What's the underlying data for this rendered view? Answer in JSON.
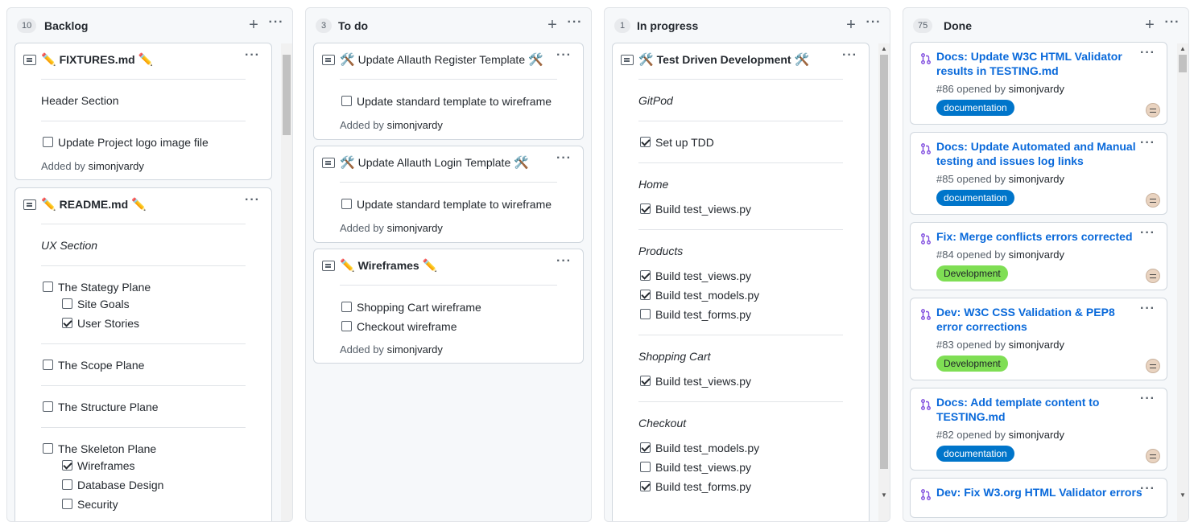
{
  "columns": [
    {
      "count": "10",
      "title": "Backlog",
      "cards": [
        {
          "kind": "note",
          "title": "FIXTURES.md",
          "emoji": "✏️",
          "items": [
            {
              "type": "text",
              "text": "Header Section"
            },
            {
              "type": "check",
              "text": "Update Project logo image file",
              "checked": false
            }
          ],
          "added_prefix": "Added by",
          "added_user": "simonjvardy"
        },
        {
          "kind": "note",
          "title": "README.md",
          "emoji": "✏️",
          "items": [
            {
              "type": "italic",
              "text": "UX Section"
            },
            {
              "type": "check",
              "text": "The Stategy Plane",
              "checked": false
            },
            {
              "type": "subcheck",
              "text": "Site Goals",
              "checked": false
            },
            {
              "type": "subcheck",
              "text": "User Stories",
              "checked": true
            },
            {
              "type": "check",
              "text": "The Scope Plane",
              "checked": false
            },
            {
              "type": "check",
              "text": "The Structure Plane",
              "checked": false
            },
            {
              "type": "check",
              "text": "The Skeleton Plane",
              "checked": false
            },
            {
              "type": "subcheck",
              "text": "Wireframes",
              "checked": true
            },
            {
              "type": "subcheck",
              "text": "Database Design",
              "checked": false
            },
            {
              "type": "subcheck",
              "text": "Security",
              "checked": false
            }
          ]
        }
      ]
    },
    {
      "count": "3",
      "title": "To do",
      "cards": [
        {
          "kind": "note",
          "title": "Update Allauth Register Template",
          "emoji": "🛠️",
          "items": [
            {
              "type": "check",
              "text": "Update standard template to wireframe",
              "checked": false
            }
          ],
          "added_prefix": "Added by",
          "added_user": "simonjvardy"
        },
        {
          "kind": "note",
          "title": "Update Allauth Login Template",
          "emoji": "🛠️",
          "items": [
            {
              "type": "check",
              "text": "Update standard template to wireframe",
              "checked": false
            }
          ],
          "added_prefix": "Added by",
          "added_user": "simonjvardy"
        },
        {
          "kind": "note",
          "title": "Wireframes",
          "emoji": "✏️",
          "items": [
            {
              "type": "check",
              "text": "Shopping Cart wireframe",
              "checked": false
            },
            {
              "type": "check",
              "text": "Checkout wireframe",
              "checked": false
            }
          ],
          "added_prefix": "Added by",
          "added_user": "simonjvardy"
        }
      ]
    },
    {
      "count": "1",
      "title": "In progress",
      "cards": [
        {
          "kind": "note",
          "title": "Test Driven Development",
          "emoji": "🛠️",
          "items": [
            {
              "type": "italic",
              "text": "GitPod"
            },
            {
              "type": "check",
              "text": "Set up TDD",
              "checked": true
            },
            {
              "type": "italic",
              "text": "Home"
            },
            {
              "type": "check",
              "text": "Build test_views.py",
              "checked": true
            },
            {
              "type": "italic",
              "text": "Products"
            },
            {
              "type": "check",
              "text": "Build test_views.py",
              "checked": true
            },
            {
              "type": "check",
              "text": "Build test_models.py",
              "checked": true
            },
            {
              "type": "check",
              "text": "Build test_forms.py",
              "checked": false
            },
            {
              "type": "italic",
              "text": "Shopping Cart"
            },
            {
              "type": "check",
              "text": "Build test_views.py",
              "checked": true
            },
            {
              "type": "italic",
              "text": "Checkout"
            },
            {
              "type": "check",
              "text": "Build test_models.py",
              "checked": true
            },
            {
              "type": "check",
              "text": "Build test_views.py",
              "checked": false
            },
            {
              "type": "check",
              "text": "Build test_forms.py",
              "checked": true
            }
          ]
        }
      ]
    },
    {
      "count": "75",
      "title": "Done",
      "cards": [
        {
          "kind": "pr",
          "title": "Docs: Update W3C HTML Validator results in TESTING.md",
          "meta_prefix": "#86 opened by",
          "user": "simonjvardy",
          "label": "documentation",
          "label_color": "#0075ca",
          "label_text_color": "#ffffff"
        },
        {
          "kind": "pr",
          "title": "Docs: Update Automated and Manual testing and issues log links",
          "meta_prefix": "#85 opened by",
          "user": "simonjvardy",
          "label": "documentation",
          "label_color": "#0075ca",
          "label_text_color": "#ffffff"
        },
        {
          "kind": "pr",
          "title": "Fix: Merge conflicts errors corrected",
          "meta_prefix": "#84 opened by",
          "user": "simonjvardy",
          "label": "Development",
          "label_color": "#7fde54",
          "label_text_color": "#1f2328"
        },
        {
          "kind": "pr",
          "title": "Dev: W3C CSS Validation & PEP8 error corrections",
          "meta_prefix": "#83 opened by",
          "user": "simonjvardy",
          "label": "Development",
          "label_color": "#7fde54",
          "label_text_color": "#1f2328"
        },
        {
          "kind": "pr",
          "title": "Docs: Add template content to TESTING.md",
          "meta_prefix": "#82 opened by",
          "user": "simonjvardy",
          "label": "documentation",
          "label_color": "#0075ca",
          "label_text_color": "#ffffff"
        },
        {
          "kind": "pr",
          "title": "Dev: Fix W3.org HTML Validator errors"
        }
      ]
    }
  ],
  "ui": {
    "add_icon": "+",
    "menu_icon": "···"
  }
}
